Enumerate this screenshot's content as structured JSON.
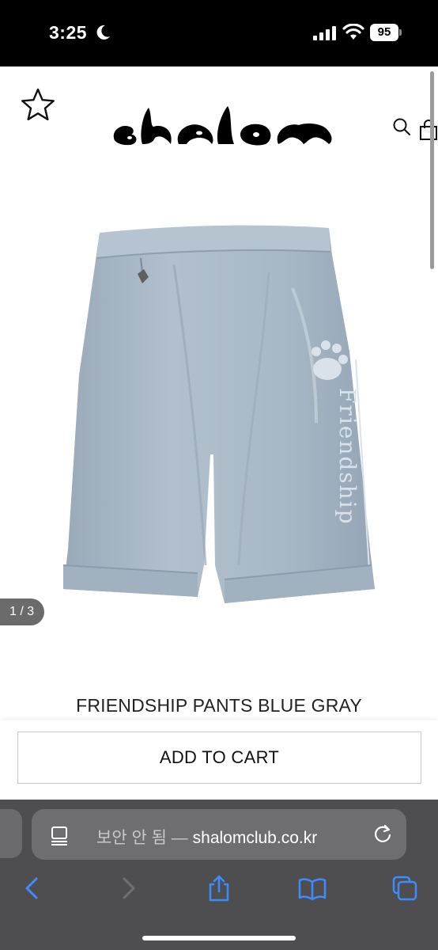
{
  "status_bar": {
    "time": "3:25",
    "battery": "95",
    "icons": [
      "moon-icon",
      "signal-icon",
      "wifi-icon",
      "battery-icon"
    ]
  },
  "site": {
    "logo_text": "shalom",
    "icons": [
      "star-icon",
      "search-icon",
      "shopping-bag-icon"
    ]
  },
  "product": {
    "image_counter": "1 / 3",
    "title": "FRIENDSHIP PANTS BLUE GRAY",
    "add_to_cart_label": "ADD TO CART",
    "image_print_text": "Friendship",
    "color": "#a7b6c4"
  },
  "browser": {
    "security_label": "보안 안 됨 —",
    "domain": "shalomclub.co.kr",
    "toolbar_icons": [
      "back-icon",
      "forward-icon",
      "share-icon",
      "bookmarks-icon",
      "tabs-icon"
    ],
    "accent": "#3e8bff"
  }
}
